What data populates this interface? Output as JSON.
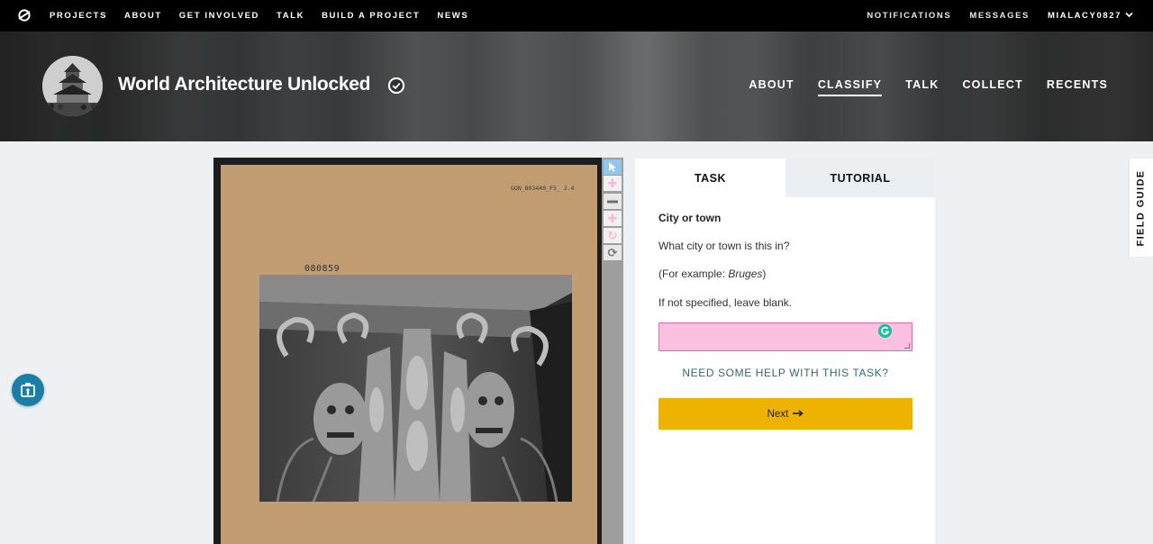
{
  "topnav": {
    "left_items": [
      "Projects",
      "About",
      "Get Involved",
      "Talk",
      "Build a Project",
      "News"
    ],
    "right_items": [
      "Notifications",
      "Messages"
    ],
    "username": "MIALACY0827"
  },
  "project": {
    "title": "World Architecture Unlocked",
    "nav": [
      "ABOUT",
      "CLASSIFY",
      "TALK",
      "COLLECT",
      "RECENTS"
    ],
    "active_nav": "CLASSIFY"
  },
  "subject": {
    "card_code": "GON_B03440_F5_ 2.4",
    "card_number": "080859"
  },
  "task_panel": {
    "tabs": [
      "TASK",
      "TUTORIAL"
    ],
    "active_tab": "TASK",
    "question_title": "City or town",
    "question_text": "What city or town is this in?",
    "example_prefix": "(For example: ",
    "example_value": "Bruges",
    "example_suffix": ")",
    "instruction": "If not specified, leave blank.",
    "answer_value": "",
    "help_link": "NEED SOME HELP WITH THIS TASK?",
    "next_label": "Next"
  },
  "field_guide": {
    "label": "FIELD GUIDE"
  },
  "colors": {
    "accent": "#eeb200",
    "input_bg": "#fcc0e0",
    "help_link": "#2e6b73",
    "fab": "#1a7fa6"
  },
  "icons": {
    "logo": "zooniverse-logo-icon",
    "verified": "check-circle-icon",
    "next": "arrow-right-icon",
    "grammarly": "grammarly-icon",
    "fab": "accessibility-icon"
  }
}
